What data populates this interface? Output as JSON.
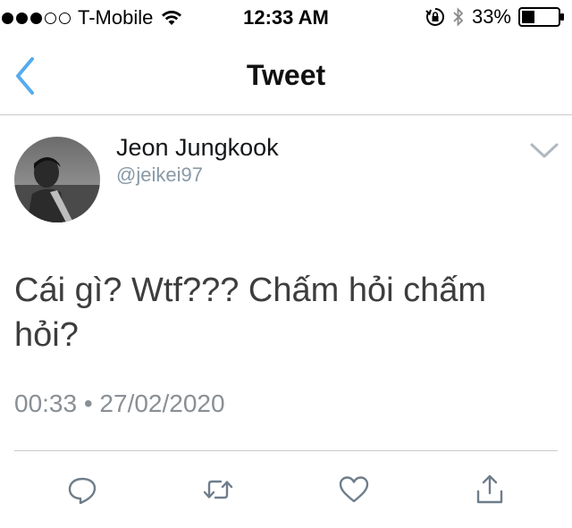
{
  "status_bar": {
    "carrier": "T-Mobile",
    "time": "12:33 AM",
    "battery": "33%",
    "signal_strength": 3,
    "icons": [
      "wifi-icon",
      "rotation-lock-icon",
      "bluetooth-icon",
      "battery-icon"
    ]
  },
  "nav": {
    "title": "Tweet",
    "back_icon": "chevron-left-icon",
    "accent_color": "#55acee"
  },
  "tweet": {
    "display_name": "Jeon Jungkook",
    "handle": "@jeikei97",
    "text": "Cái gì? Wtf??? Chấm hỏi chấm hỏi?",
    "timestamp": "00:33 • 27/02/2020"
  },
  "actions": [
    {
      "name": "reply",
      "icon": "reply-icon"
    },
    {
      "name": "retweet",
      "icon": "retweet-icon"
    },
    {
      "name": "like",
      "icon": "heart-icon"
    },
    {
      "name": "share",
      "icon": "share-icon"
    }
  ],
  "colors": {
    "icon_gray": "#6e7d8a",
    "secondary_text": "#8899a6"
  }
}
